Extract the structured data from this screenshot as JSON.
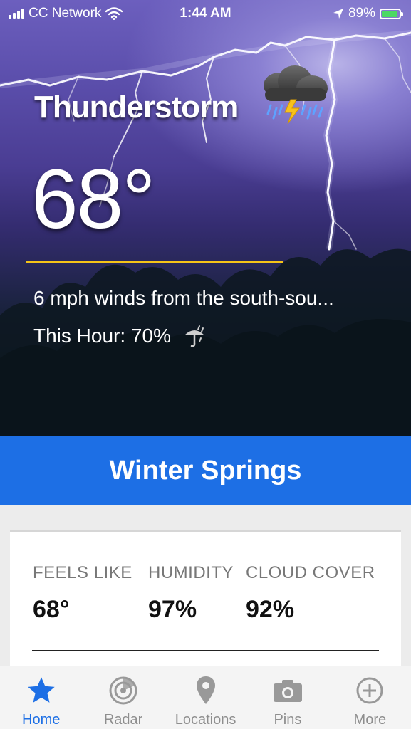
{
  "status_bar": {
    "carrier": "CC Network",
    "time": "1:44 AM",
    "battery": "89%"
  },
  "current": {
    "condition": "Thunderstorm",
    "temperature": "68°",
    "wind": "6 mph winds from the south-sou...",
    "precip": "This Hour: 70%"
  },
  "location": {
    "name": "Winter Springs"
  },
  "details": {
    "metrics": [
      {
        "label": "FEELS LIKE",
        "value": "68°"
      },
      {
        "label": "HUMIDITY",
        "value": "97%"
      },
      {
        "label": "CLOUD COVER",
        "value": "92%"
      }
    ]
  },
  "tabs": [
    {
      "label": "Home",
      "icon": "star-icon",
      "active": true
    },
    {
      "label": "Radar",
      "icon": "radar-icon",
      "active": false
    },
    {
      "label": "Locations",
      "icon": "map-pin-icon",
      "active": false
    },
    {
      "label": "Pins",
      "icon": "camera-icon",
      "active": false
    },
    {
      "label": "More",
      "icon": "plus-circle-icon",
      "active": false
    }
  ],
  "colors": {
    "accent": "#1d6fe5",
    "divider": "#f5c418",
    "battery": "#4cd964"
  }
}
